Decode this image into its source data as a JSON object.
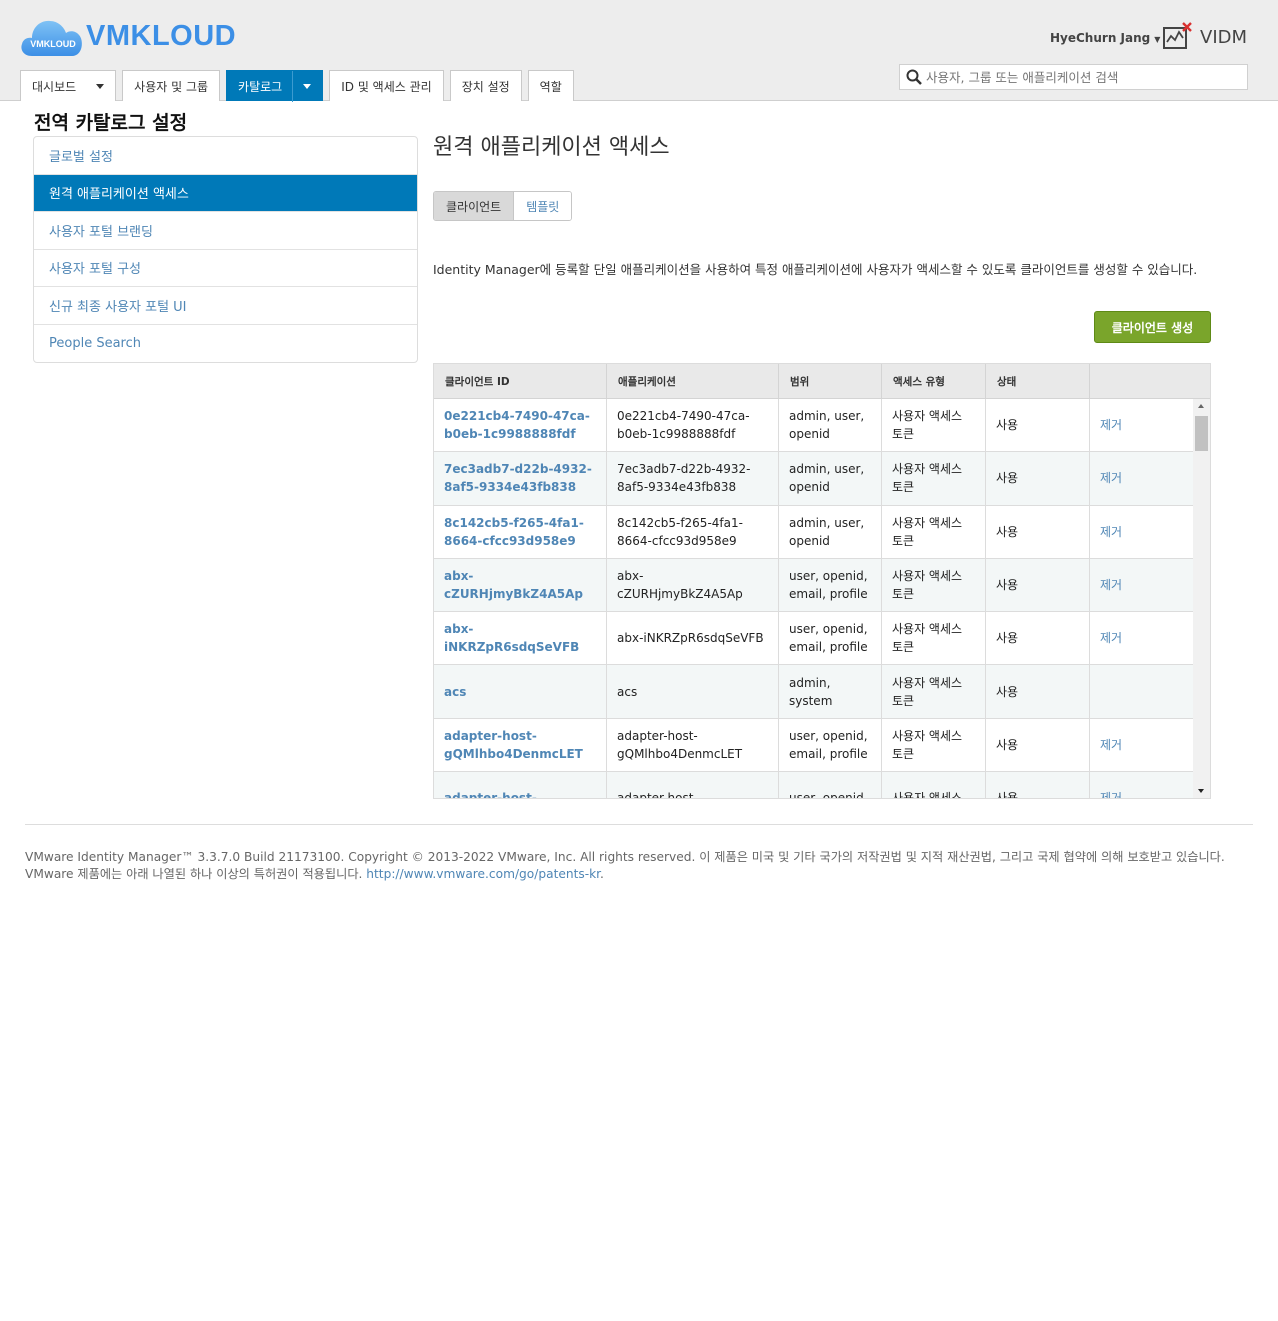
{
  "brand": {
    "logo_badge": "VMKLOUD",
    "name": "VMKLOUD",
    "color": "#3c8fe6"
  },
  "user": {
    "name": "HyeChurn Jang",
    "app_name": "VIDM"
  },
  "nav": {
    "tabs": [
      {
        "label": "대시보드",
        "dropdown": true
      },
      {
        "label": "사용자 및 그룹"
      },
      {
        "label": "카탈로그",
        "dropdown": true,
        "active": true
      },
      {
        "label": "ID 및 액세스 관리"
      },
      {
        "label": "장치 설정"
      },
      {
        "label": "역할"
      }
    ],
    "search_placeholder": "사용자, 그룹 또는 애플리케이션 검색"
  },
  "sidebar": {
    "title": "전역 카탈로그 설정",
    "items": [
      {
        "label": "글로벌 설정"
      },
      {
        "label": "원격 애플리케이션 액세스",
        "active": true
      },
      {
        "label": "사용자 포털 브랜딩"
      },
      {
        "label": "사용자 포털 구성"
      },
      {
        "label": "신규 최종 사용자 포털 UI"
      },
      {
        "label": "People Search"
      }
    ]
  },
  "main": {
    "title": "원격 애플리케이션 액세스",
    "segments": [
      {
        "label": "클라이언트",
        "selected": true
      },
      {
        "label": "템플릿"
      }
    ],
    "description": "Identity Manager에 등록할 단일 애플리케이션을 사용하여 특정 애플리케이션에 사용자가 액세스할 수 있도록 클라이언트를 생성할 수 있습니다.",
    "create_button": "클라이언트 생성",
    "table": {
      "columns": [
        "클라이언트 ID",
        "애플리케이션",
        "범위",
        "액세스 유형",
        "상태",
        ""
      ],
      "rows": [
        {
          "client_id": "0e221cb4-7490-47ca-b0eb-1c9988888fdf",
          "app": "0e221cb4-7490-47ca-b0eb-1c9988888fdf",
          "scope": "admin, user, openid",
          "access": "사용자 액세스 토큰",
          "status": "사용",
          "action": "제거"
        },
        {
          "client_id": "7ec3adb7-d22b-4932-8af5-9334e43fb838",
          "app": "7ec3adb7-d22b-4932-8af5-9334e43fb838",
          "scope": "admin, user, openid",
          "access": "사용자 액세스 토큰",
          "status": "사용",
          "action": "제거"
        },
        {
          "client_id": "8c142cb5-f265-4fa1-8664-cfcc93d958e9",
          "app": "8c142cb5-f265-4fa1-8664-cfcc93d958e9",
          "scope": "admin, user, openid",
          "access": "사용자 액세스 토큰",
          "status": "사용",
          "action": "제거"
        },
        {
          "client_id": "abx-cZURHjmyBkZ4A5Ap",
          "app": "abx-cZURHjmyBkZ4A5Ap",
          "scope": "user, openid, email, profile",
          "access": "사용자 액세스 토큰",
          "status": "사용",
          "action": "제거"
        },
        {
          "client_id": "abx-iNKRZpR6sdqSeVFB",
          "app": "abx-iNKRZpR6sdqSeVFB",
          "scope": "user, openid, email, profile",
          "access": "사용자 액세스 토큰",
          "status": "사용",
          "action": "제거"
        },
        {
          "client_id": "acs",
          "app": "acs",
          "scope": "admin, system",
          "access": "사용자 액세스 토큰",
          "status": "사용",
          "action": ""
        },
        {
          "client_id": "adapter-host-gQMlhbo4DenmcLET",
          "app": "adapter-host-gQMlhbo4DenmcLET",
          "scope": "user, openid, email, profile",
          "access": "사용자 액세스 토큰",
          "status": "사용",
          "action": "제거"
        },
        {
          "client_id": "adapter-host-",
          "app": "adapter-host-",
          "scope": "user, openid,",
          "access": "사용자 액세스",
          "status": "사용",
          "action": "제거"
        }
      ]
    }
  },
  "footer": {
    "text": "VMware Identity Manager™ 3.3.7.0 Build 21173100. Copyright © 2013-2022 VMware, Inc. All rights reserved. 이 제품은 미국 및 기타 국가의 저작권법 및 지적 재산권법, 그리고 국제 협약에 의해 보호받고 있습니다. VMware 제품에는 아래 나열된 하나 이상의 특허권이 적용됩니다. ",
    "link": "http://www.vmware.com/go/patents-kr",
    "after_link": "."
  }
}
